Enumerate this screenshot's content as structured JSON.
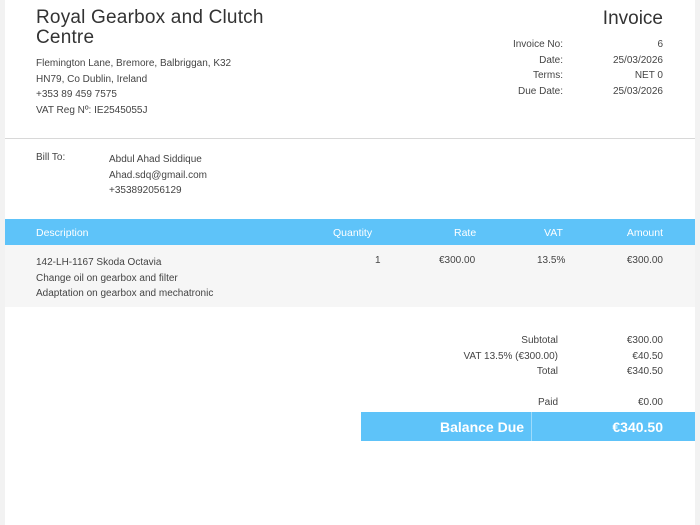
{
  "company": {
    "name": "Royal Gearbox and Clutch Centre",
    "address_line1": "Flemington Lane, Bremore, Balbriggan, K32",
    "address_line2": "HN79, Co Dublin, Ireland",
    "phone": "+353 89 459 7575",
    "vat_reg": "VAT Reg Nº: IE2545055J"
  },
  "invoice": {
    "title": "Invoice",
    "meta": [
      {
        "label": "Invoice No:",
        "value": "6"
      },
      {
        "label": "Date:",
        "value": "25/03/2026"
      },
      {
        "label": "Terms:",
        "value": "NET 0"
      },
      {
        "label": "Due Date:",
        "value": "25/03/2026"
      }
    ]
  },
  "bill_to": {
    "label": "Bill To:",
    "name": "Abdul Ahad Siddique",
    "email": "Ahad.sdq@gmail.com",
    "phone": "+353892056129"
  },
  "table": {
    "headers": [
      "Description",
      "Quantity",
      "Rate",
      "VAT",
      "Amount"
    ],
    "rows": [
      {
        "description": [
          "142-LH-1167 Skoda Octavia",
          "Change oil on gearbox and filter",
          "Adaptation on gearbox and mechatronic"
        ],
        "quantity": "1",
        "rate": "€300.00",
        "vat": "13.5%",
        "amount": "€300.00"
      }
    ]
  },
  "totals": {
    "subtotal_label": "Subtotal",
    "subtotal_value": "€300.00",
    "vat_label": "VAT 13.5% (€300.00)",
    "vat_value": "€40.50",
    "total_label": "Total",
    "total_value": "€340.50",
    "paid_label": "Paid",
    "paid_value": "€0.00",
    "balance_label": "Balance Due",
    "balance_value": "€340.50"
  },
  "colors": {
    "accent": "#5ec3f9"
  }
}
